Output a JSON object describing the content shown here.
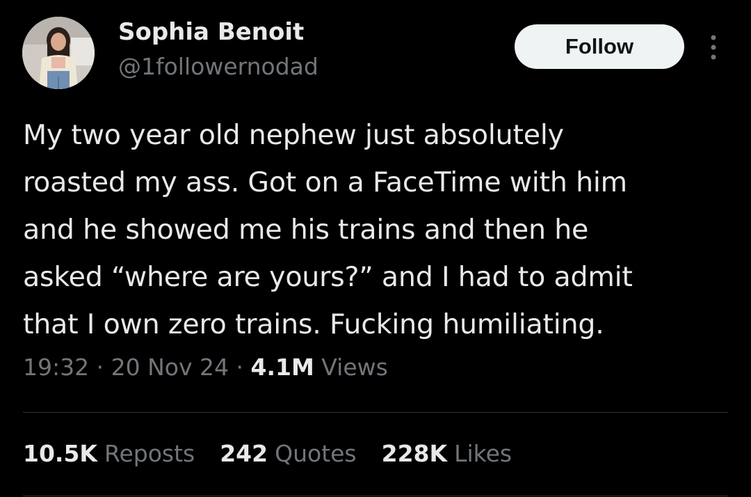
{
  "user": {
    "display_name": "Sophia Benoit",
    "handle": "@1followernodad"
  },
  "actions": {
    "follow_label": "Follow",
    "more_icon": "more-vertical-icon"
  },
  "tweet": {
    "text": "My two year old nephew just absolutely\nroasted my ass. Got on a FaceTime with him\nand he showed me his trains and then he\nasked “where are yours?” and I had to admit\nthat I own zero trains. Fucking humiliating.",
    "time": "19:32",
    "separator": "·",
    "date": "20 Nov 24",
    "views_count": "4.1M",
    "views_label": "Views"
  },
  "stats": {
    "reposts_count": "10.5K",
    "reposts_label": "Reposts",
    "quotes_count": "242",
    "quotes_label": "Quotes",
    "likes_count": "228K",
    "likes_label": "Likes"
  },
  "colors": {
    "background": "#000000",
    "primary_text": "#e7e9ea",
    "secondary_text": "#71767b",
    "follow_button_bg": "#eff3f4",
    "divider": "#2f3336"
  }
}
